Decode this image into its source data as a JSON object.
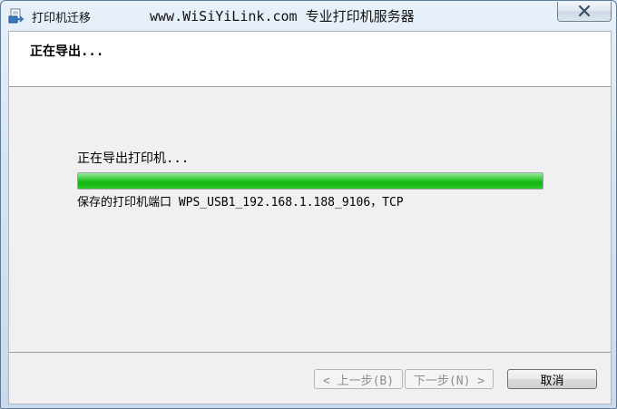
{
  "window": {
    "title": "打印机迁移",
    "center_banner": "www.WiSiYiLink.com 专业打印机服务器",
    "close_icon": "close-icon"
  },
  "header": {
    "title": "正在导出..."
  },
  "main": {
    "status_text": "正在导出打印机...",
    "progress_percent": 100,
    "port_text": "保存的打印机端口 WPS_USB1_192.168.1.188_9106，TCP"
  },
  "footer": {
    "back_label": "< 上一步(B)",
    "next_label": "下一步(N) >",
    "cancel_label": "取消"
  },
  "colors": {
    "progress_green": "#12b512",
    "header_bg": "#ffffff",
    "client_bg": "#f0f0f0"
  }
}
